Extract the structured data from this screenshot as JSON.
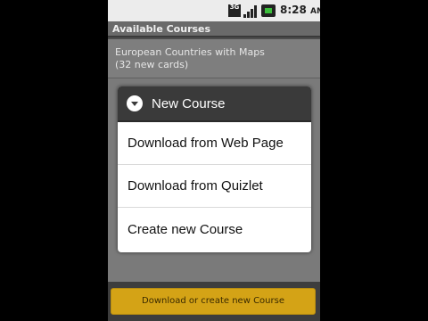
{
  "status_bar": {
    "network_label": "3G",
    "time": "8:28",
    "ampm": "AM"
  },
  "app": {
    "title": "Available Courses"
  },
  "course_list": {
    "items": [
      {
        "title": "European Countries with Maps",
        "subtitle": "(32 new cards)"
      }
    ]
  },
  "dialog": {
    "title": "New Course",
    "options": [
      {
        "label": "Download from Web Page"
      },
      {
        "label": "Download from Quizlet"
      },
      {
        "label": "Create new Course"
      }
    ]
  },
  "footer": {
    "button_label": "Download or create new Course"
  },
  "colors": {
    "accent": "#d4a316",
    "titlebar": "#6a6a6a",
    "dialog_header": "#3a3a3a"
  }
}
